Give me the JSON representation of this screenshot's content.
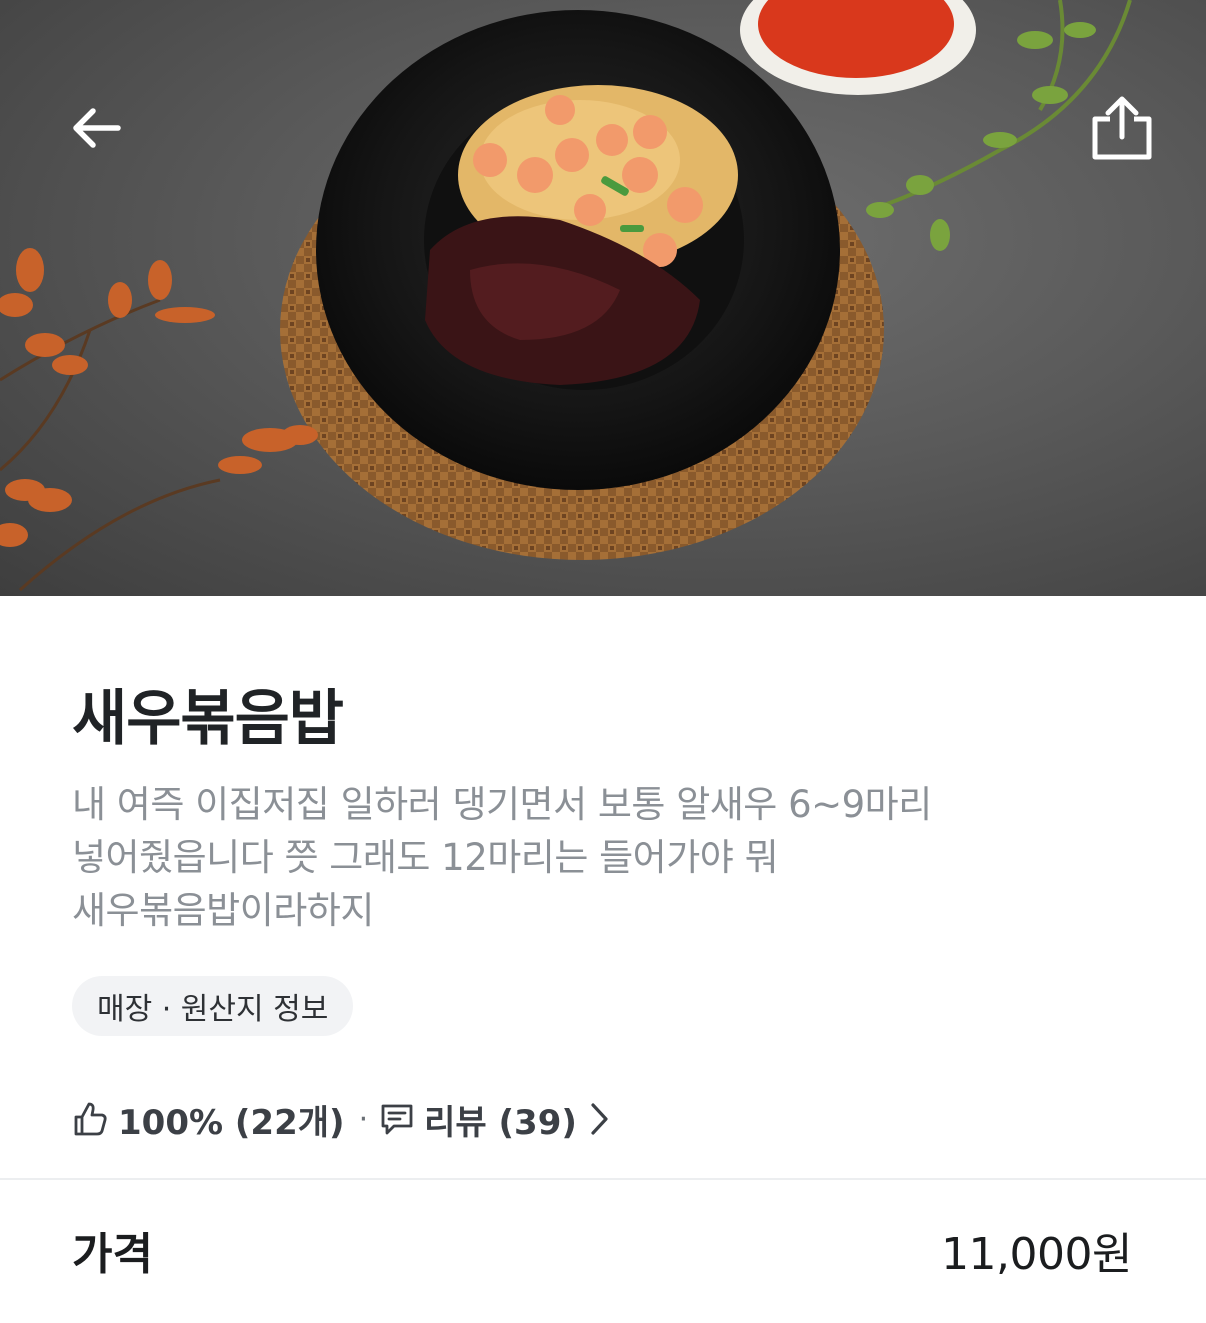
{
  "header": {
    "back_icon": "arrow-left-icon",
    "share_icon": "share-icon"
  },
  "menu": {
    "name": "새우볶음밥",
    "description_lines": [
      "내 여즉 이집저집 일하러 댕기면서 보통 알새우 6~9마리",
      "넣어줬읍니다 쯧 그래도 12마리는 들어가야 뭐",
      "새우볶음밥이라하지"
    ],
    "info_chip": "매장 · 원산지 정보"
  },
  "stats": {
    "like_icon": "thumbs-up-icon",
    "like_text": "100% (22개)",
    "separator": "·",
    "review_icon": "comment-icon",
    "review_text": "리뷰 (39)",
    "chevron_icon": "chevron-right-icon"
  },
  "price": {
    "label": "가격",
    "value": "11,000원"
  },
  "colors": {
    "title": "#202326",
    "description": "#8b9096",
    "chip_bg": "#f2f3f5",
    "divider": "#eceef0"
  }
}
